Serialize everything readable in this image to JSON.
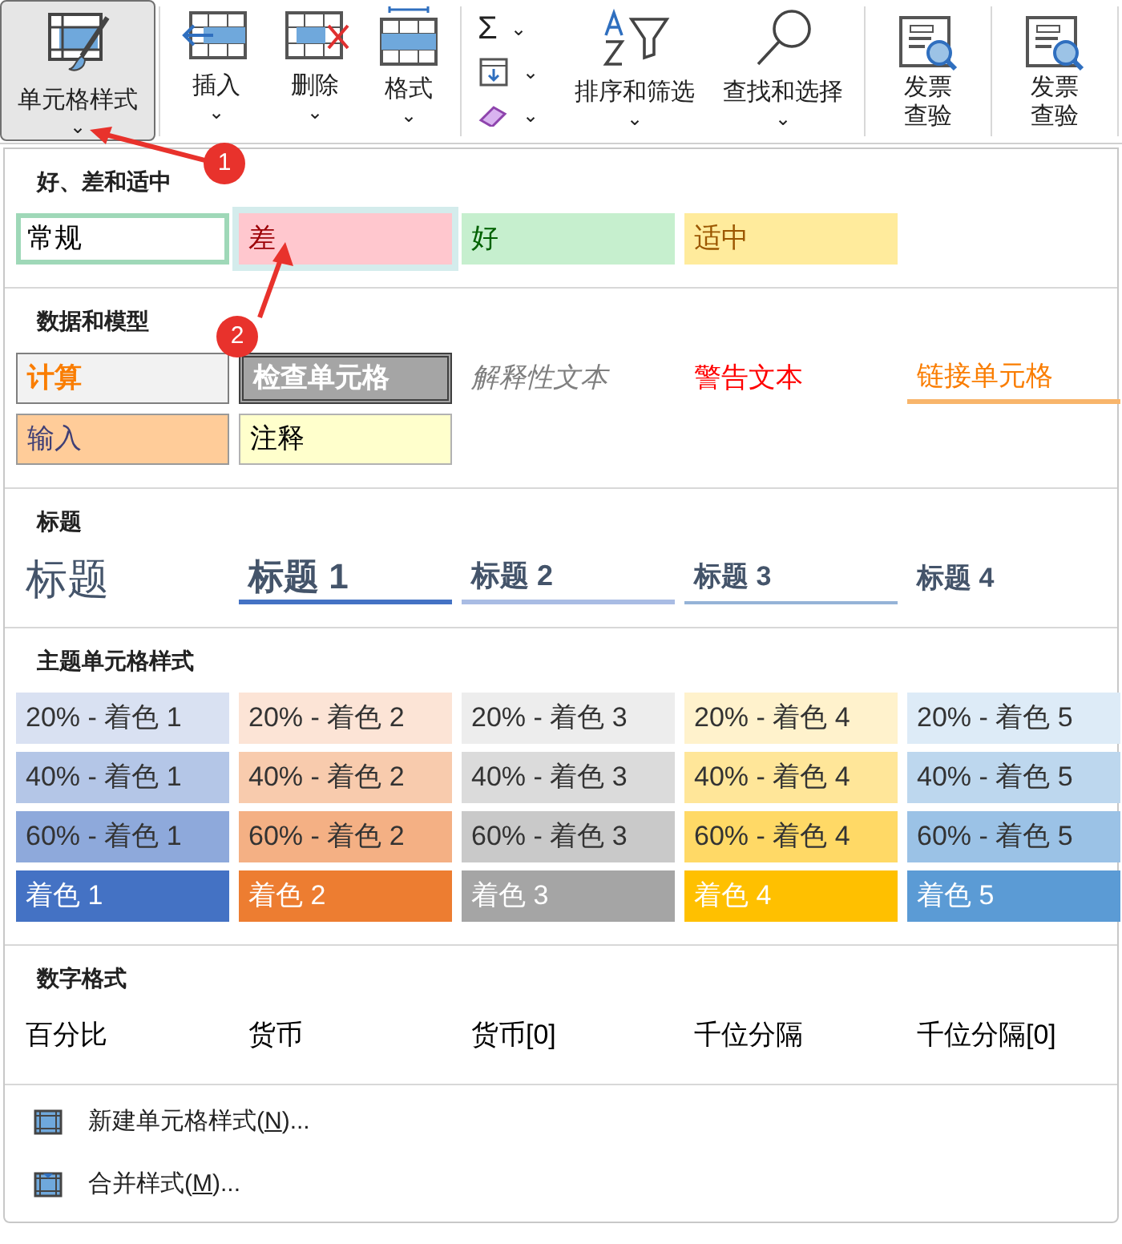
{
  "ribbon": {
    "commands": [
      {
        "kind": "large",
        "label": "单元格样式",
        "caret": "⌄",
        "selected": true
      },
      {
        "kind": "large",
        "label": "插入",
        "caret": "⌄",
        "selected": false
      },
      {
        "kind": "large",
        "label": "删除",
        "caret": "⌄",
        "selected": false
      },
      {
        "kind": "large",
        "label": "格式",
        "caret": "⌄",
        "selected": false
      },
      {
        "kind": "small_group",
        "items": [
          {
            "symbol": "Σ",
            "caret": "⌄"
          },
          {
            "caret": "⌄"
          },
          {
            "caret": "⌄"
          }
        ]
      },
      {
        "kind": "large",
        "label": "排序和筛选",
        "caret": "⌄",
        "selected": false
      },
      {
        "kind": "large",
        "label": "查找和选择",
        "caret": "⌄",
        "selected": false
      },
      {
        "kind": "invoice",
        "lines": [
          "发票",
          "查验"
        ],
        "selected": false
      },
      {
        "kind": "invoice",
        "lines": [
          "发票",
          "查验"
        ],
        "selected": false
      }
    ]
  },
  "gallery": {
    "sections": [
      {
        "title": "好、差和适中",
        "kind": "styles",
        "tiles": [
          {
            "kind": "normal",
            "label": "常规",
            "selected": true,
            "hovered": false
          },
          {
            "kind": "bad",
            "label": "差",
            "selected": false,
            "hovered": true
          },
          {
            "kind": "good",
            "label": "好",
            "selected": false,
            "hovered": false
          },
          {
            "kind": "neutral",
            "label": "适中",
            "selected": false,
            "hovered": false
          }
        ]
      },
      {
        "title": "数据和模型",
        "kind": "styles",
        "tiles": [
          {
            "kind": "calculation",
            "label": "计算"
          },
          {
            "kind": "check",
            "label": "检查单元格"
          },
          {
            "kind": "explanatory",
            "label": "解释性文本"
          },
          {
            "kind": "warning",
            "label": "警告文本"
          },
          {
            "kind": "linked",
            "label": "链接单元格"
          },
          {
            "kind": "input",
            "label": "输入"
          },
          {
            "kind": "note",
            "label": "注释"
          }
        ]
      },
      {
        "title": "标题",
        "kind": "styles",
        "tiles": [
          {
            "kind": "title",
            "label": "标题"
          },
          {
            "kind": "heading1",
            "label": "标题 1"
          },
          {
            "kind": "heading2",
            "label": "标题 2"
          },
          {
            "kind": "heading3",
            "label": "标题 3"
          },
          {
            "kind": "heading4",
            "label": "标题 4"
          }
        ]
      },
      {
        "title": "主题单元格样式",
        "kind": "theme",
        "rows": [
          {
            "kind": "tint",
            "tiles": [
              {
                "label": "20% - 着色 1",
                "color": "#d9e1f2"
              },
              {
                "label": "20% - 着色 2",
                "color": "#fce4d6"
              },
              {
                "label": "20% - 着色 3",
                "color": "#ededed"
              },
              {
                "label": "20% - 着色 4",
                "color": "#fff2cc"
              },
              {
                "label": "20% - 着色 5",
                "color": "#ddebf7"
              }
            ]
          },
          {
            "kind": "tint",
            "tiles": [
              {
                "label": "40% - 着色 1",
                "color": "#b4c6e7"
              },
              {
                "label": "40% - 着色 2",
                "color": "#f8cbad"
              },
              {
                "label": "40% - 着色 3",
                "color": "#dbdbdb"
              },
              {
                "label": "40% - 着色 4",
                "color": "#ffe699"
              },
              {
                "label": "40% - 着色 5",
                "color": "#bdd7ee"
              }
            ]
          },
          {
            "kind": "tint",
            "tiles": [
              {
                "label": "60% - 着色 1",
                "color": "#8ea9db"
              },
              {
                "label": "60% - 着色 2",
                "color": "#f4b084"
              },
              {
                "label": "60% - 着色 3",
                "color": "#c9c9c9"
              },
              {
                "label": "60% - 着色 4",
                "color": "#ffd966"
              },
              {
                "label": "60% - 着色 5",
                "color": "#9bc2e6"
              }
            ]
          },
          {
            "kind": "solid",
            "tiles": [
              {
                "label": "着色 1",
                "color": "#4472c4"
              },
              {
                "label": "着色 2",
                "color": "#ed7d31"
              },
              {
                "label": "着色 3",
                "color": "#a5a5a5"
              },
              {
                "label": "着色 4",
                "color": "#ffc000"
              },
              {
                "label": "着色 5",
                "color": "#5b9bd5"
              }
            ]
          }
        ]
      },
      {
        "title": "数字格式",
        "kind": "styles",
        "tiles": [
          {
            "kind": "plain",
            "label": "百分比"
          },
          {
            "kind": "plain",
            "label": "货币"
          },
          {
            "kind": "plain",
            "label": "货币[0]"
          },
          {
            "kind": "plain",
            "label": "千位分隔"
          },
          {
            "kind": "plain",
            "label": "千位分隔[0]"
          }
        ]
      }
    ],
    "menu": [
      {
        "kind": "new",
        "before": "新建单元格样式(",
        "access_key": "N",
        "after": ")..."
      },
      {
        "kind": "merge",
        "before": "合并样式(",
        "access_key": "M",
        "after": ")..."
      }
    ]
  },
  "annotations": [
    {
      "label": "1"
    },
    {
      "label": "2"
    }
  ]
}
